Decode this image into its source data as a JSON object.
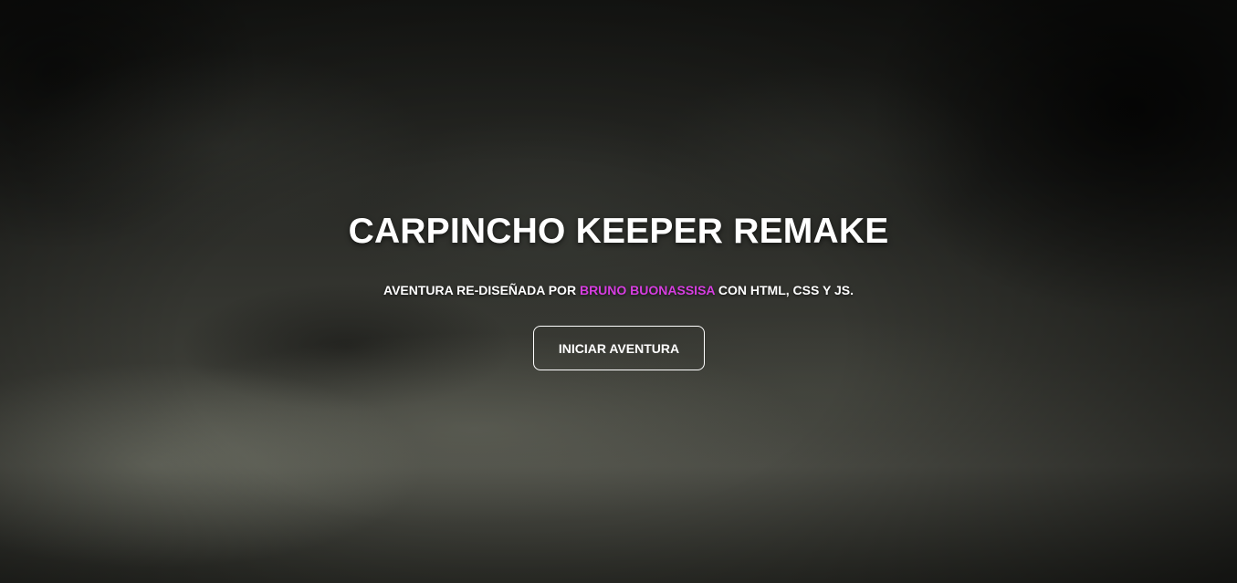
{
  "hero": {
    "title": "CARPINCHO KEEPER REMAKE",
    "subtitle_prefix": "AVENTURA RE-DISEÑADA POR ",
    "author": "BRUNO BUONASSISA",
    "subtitle_suffix": " CON HTML, CSS Y JS.",
    "start_label": "INICIAR AVENTURA"
  },
  "colors": {
    "text": "#ffffff",
    "author_accent": "#d63ee0",
    "button_border": "#ffffff"
  }
}
